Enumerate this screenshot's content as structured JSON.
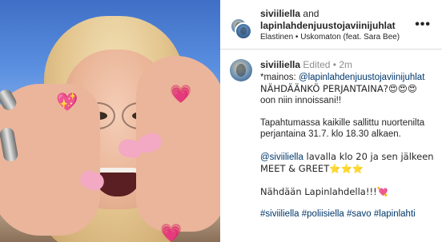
{
  "post": {
    "header": {
      "author": "siviiliella",
      "and_word": "and",
      "coauthor": "lapinlahdenjuustojaviinijuhlat",
      "audio": "Elastinen • Uskomaton (feat. Sara Bee)",
      "more_icon": "•••"
    },
    "caption": {
      "user": "siviiliella",
      "edited": "Edited",
      "dot": "•",
      "time": "2m",
      "line1_prefix": "*mainos: ",
      "line1_mention": "@lapinlahdenjuustojaviinijuhlat",
      "line2": "NÄHDÄÄNKÖ PERJANTAINA?😍😍😍",
      "line3": "oon niin innoissani!!",
      "para2": "Tapahtumassa kaikille sallittu nuortenilta perjantaina 31.7. klo 18.30 alkaen.",
      "para3_mention": "@siviiliella",
      "para3_rest": " lavalla klo 20 ja sen jälkeen MEET & GREET⭐⭐⭐",
      "para4": "Nähdään Lapinlahdella!!!💘",
      "hashtags": "#siviiliella #poliisiella #savo #lapinlahti"
    }
  },
  "media": {
    "stickers": [
      "💖",
      "💗",
      "💗"
    ]
  },
  "colors": {
    "link": "#00376b",
    "text": "#262626",
    "muted": "#8e8e8e"
  }
}
